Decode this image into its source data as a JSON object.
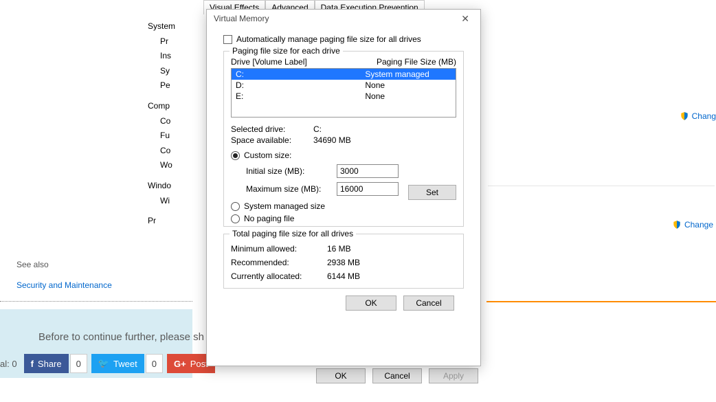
{
  "bg_left": {
    "system_label": "System",
    "items1": [
      "Pr",
      "Ins",
      "Sy",
      "Pe"
    ],
    "comp_label": "Comp",
    "items2": [
      "Co",
      "Fu",
      "Co",
      "Wo"
    ],
    "windo_label": "Windo",
    "items3": [
      "Wi"
    ],
    "pr_label": "Pr"
  },
  "see_also": {
    "heading": "See also",
    "link": "Security and Maintenance"
  },
  "right_links": {
    "change": "Chang",
    "change_p": "Change p"
  },
  "lowbar_text": "Before to continue further, please sh",
  "social": {
    "prefix": "al: 0",
    "share": "Share",
    "share_count": "0",
    "tweet": "Tweet",
    "tweet_count": "0",
    "post": "Post"
  },
  "parent_tabs": [
    "Visual Effects",
    "Advanced",
    "Data Execution Prevention"
  ],
  "parent_bottom": {
    "ok": "OK",
    "cancel": "Cancel",
    "apply": "Apply"
  },
  "vm": {
    "title": "Virtual Memory",
    "auto_label": "Automatically manage paging file size for all drives",
    "group1_title": "Paging file size for each drive",
    "col_drive": "Drive  [Volume Label]",
    "col_size": "Paging File Size (MB)",
    "drives": [
      {
        "label": "C:",
        "status": "System managed",
        "selected": true
      },
      {
        "label": "D:",
        "status": "None",
        "selected": false
      },
      {
        "label": "E:",
        "status": "None",
        "selected": false
      }
    ],
    "selected_drive_label": "Selected drive:",
    "selected_drive_value": "C:",
    "space_label": "Space available:",
    "space_value": "34690 MB",
    "custom_label": "Custom size:",
    "initial_label": "Initial size (MB):",
    "initial_value": "3000",
    "max_label": "Maximum size (MB):",
    "max_value": "16000",
    "sysman_label": "System managed size",
    "nopage_label": "No paging file",
    "set_btn": "Set",
    "group2_title": "Total paging file size for all drives",
    "min_label": "Minimum allowed:",
    "min_value": "16 MB",
    "rec_label": "Recommended:",
    "rec_value": "2938 MB",
    "cur_label": "Currently allocated:",
    "cur_value": "6144 MB",
    "ok": "OK",
    "cancel": "Cancel"
  }
}
